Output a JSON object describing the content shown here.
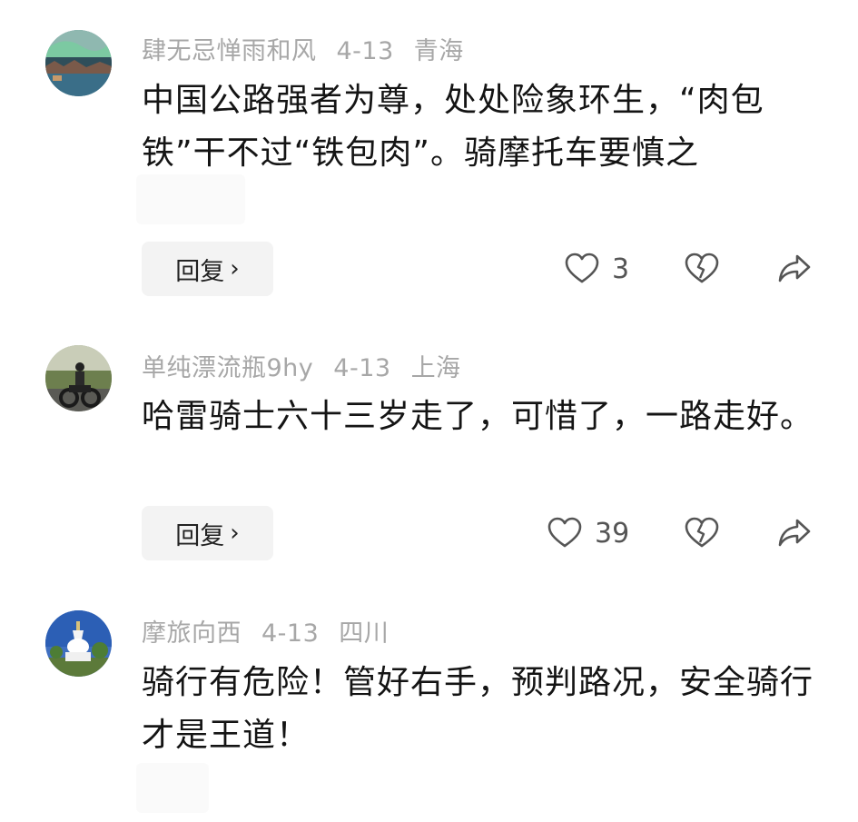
{
  "comments": [
    {
      "username": "肆无忌惮雨和风",
      "date": "4-13",
      "location": "青海",
      "text": "中国公路强者为尊，处处险象环生，“肉包铁”干不过“铁包肉”。骑摩托车要慎之",
      "reply_label": "回复",
      "like_count": "3",
      "avatar_icon": "northern-lights-landscape"
    },
    {
      "username": "单纯漂流瓶9hy",
      "date": "4-13",
      "location": "上海",
      "text": "哈雷骑士六十三岁走了，可惜了，一路走好。",
      "reply_label": "回复",
      "like_count": "39",
      "avatar_icon": "motorcycle-rider"
    },
    {
      "username": "摩旅向西",
      "date": "4-13",
      "location": "四川",
      "text": "骑行有危险！管好右手，预判路况，安全骑行才是王道！",
      "avatar_icon": "white-stupa"
    }
  ],
  "colors": {
    "meta": "#a7a7a7",
    "text": "#141414",
    "icon": "#555555",
    "reply_bg": "#f3f3f3"
  }
}
